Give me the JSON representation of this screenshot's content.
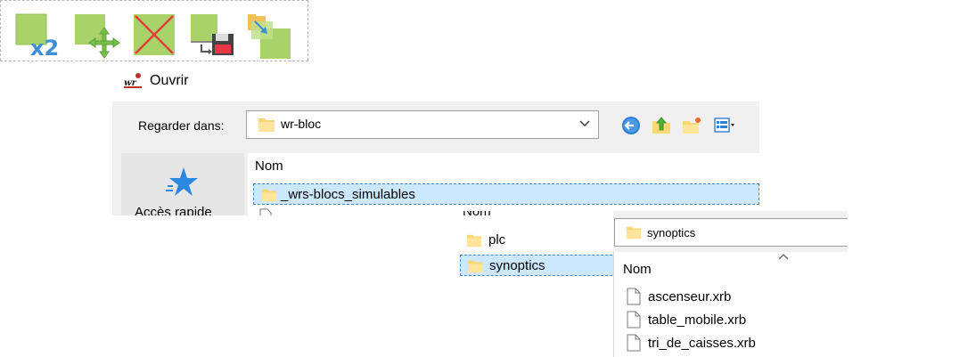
{
  "toolbar": {
    "buttons": [
      {
        "name": "duplicate-x2",
        "badge": "x2"
      },
      {
        "name": "move"
      },
      {
        "name": "delete"
      },
      {
        "name": "save"
      },
      {
        "name": "import"
      }
    ],
    "accent_green": "#a9d26b",
    "accent_blue": "#3b8fd6",
    "accent_red": "#e0403a"
  },
  "dialog": {
    "title": "Ouvrir",
    "look_in_label": "Regarder dans:",
    "look_in_value": "wr-bloc",
    "places": {
      "quick_access_label": "Accès rapide"
    },
    "column_header": "Nom",
    "selected_item": "_wrs-blocs_simulables",
    "selection_color": "#cce8ff"
  },
  "panel2": {
    "column_header": "Nom",
    "items": [
      "plc",
      "synoptics"
    ],
    "selected": "synoptics"
  },
  "panel3": {
    "look_in_value": "synoptics",
    "column_header": "Nom",
    "files": [
      "ascenseur.xrb",
      "table_mobile.xrb",
      "tri_de_caisses.xrb"
    ]
  }
}
